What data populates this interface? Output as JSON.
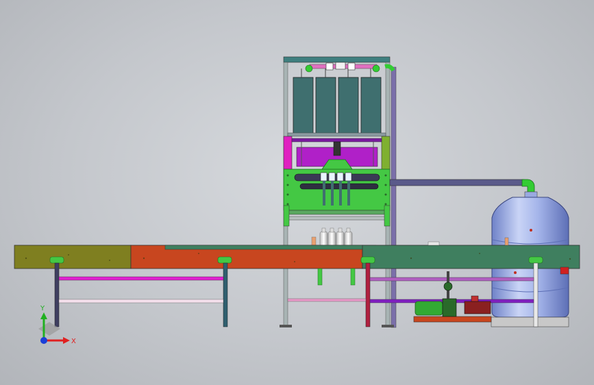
{
  "axes": {
    "x_label": "X",
    "y_label": "Y",
    "x_color": "#e02020",
    "y_color": "#20b020",
    "origin_color": "#1b3fd8"
  },
  "colors": {
    "conveyor_left": "#7f7f20",
    "conveyor_mid": "#c8461f",
    "conveyor_right": "#3f7f5f",
    "frame": "#8a9aa0",
    "tank": "#98aae6",
    "pipe": "#5a5a8a",
    "elbow": "#33cc33",
    "filler_panel": "#44c844",
    "magenta_panel": "#e020c0",
    "reservoir": "#3f6f6f"
  }
}
